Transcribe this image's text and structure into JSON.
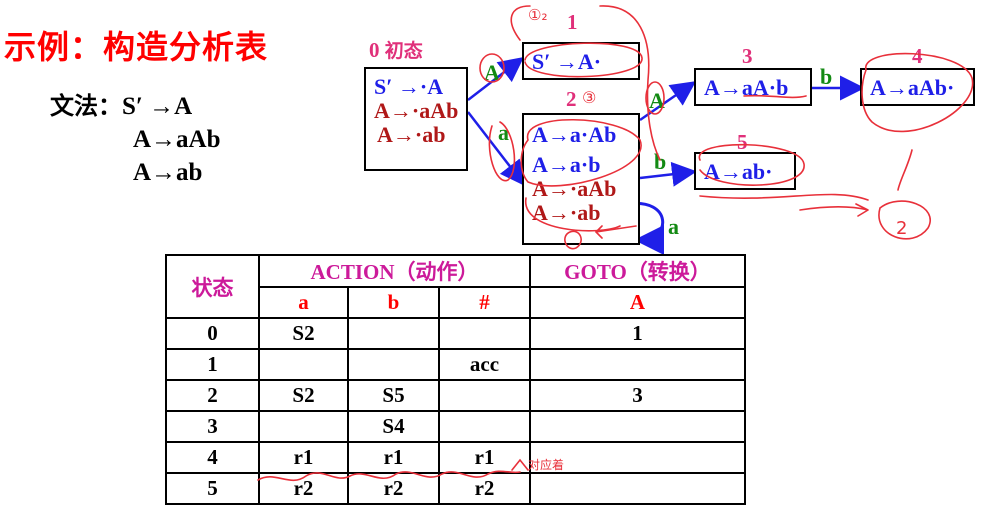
{
  "title": "示例：构造分析表",
  "grammar": {
    "label": "文法：",
    "rules": [
      "S′ →A",
      "A→aAb",
      "A→ab"
    ]
  },
  "automaton": {
    "states": [
      {
        "num": "0",
        "label": "初态",
        "items": [
          {
            "text": "S′ →·A",
            "color": "#1f1fe8"
          },
          {
            "text": "A→·aAb",
            "color": "#b01818"
          },
          {
            "text": "A→·ab",
            "color": "#b01818"
          }
        ]
      },
      {
        "num": "1",
        "items": [
          {
            "text": "S′ →A·",
            "color": "#1f1fe8"
          }
        ]
      },
      {
        "num": "2",
        "items": [
          {
            "text": "A→a·Ab",
            "color": "#1f1fe8"
          },
          {
            "text": "A→a·b",
            "color": "#1f1fe8"
          },
          {
            "text": "A→·aAb",
            "color": "#b01818"
          },
          {
            "text": "A→·ab",
            "color": "#b01818"
          }
        ]
      },
      {
        "num": "3",
        "items": [
          {
            "text": "A→aA·b",
            "color": "#1f1fe8"
          }
        ]
      },
      {
        "num": "4",
        "items": [
          {
            "text": "A→aAb·",
            "color": "#1f1fe8"
          }
        ]
      },
      {
        "num": "5",
        "items": [
          {
            "text": "A→ab·",
            "color": "#1f1fe8"
          }
        ]
      }
    ],
    "edge_labels": {
      "e01": "A",
      "e02": "a",
      "e23": "A",
      "e34": "b",
      "e25": "b",
      "e22": "a"
    }
  },
  "table": {
    "state_header": "状态",
    "action_header": "ACTION（动作）",
    "goto_header": "GOTO（转换）",
    "sub_headers": [
      "a",
      "b",
      "#",
      "A"
    ],
    "rows": [
      [
        "0",
        "S2",
        "",
        "",
        "1"
      ],
      [
        "1",
        "",
        "",
        "acc",
        ""
      ],
      [
        "2",
        "S2",
        "S5",
        "",
        "3"
      ],
      [
        "3",
        "",
        "S4",
        "",
        ""
      ],
      [
        "4",
        "r1",
        "r1",
        "r1",
        ""
      ],
      [
        "5",
        "r2",
        "r2",
        "r2",
        ""
      ]
    ]
  },
  "annotations": {
    "table_note": "对应着"
  },
  "colors": {
    "title": "#ff0000",
    "item_blue": "#1f1fe8",
    "item_darkred": "#b01818",
    "state_number": "#e0307a",
    "edge_label": "#138a13",
    "arrow": "#1f1fe8",
    "table_header": "#cc1a9a",
    "sub_header": "#ff0000",
    "handwriting": "#e8303a"
  }
}
